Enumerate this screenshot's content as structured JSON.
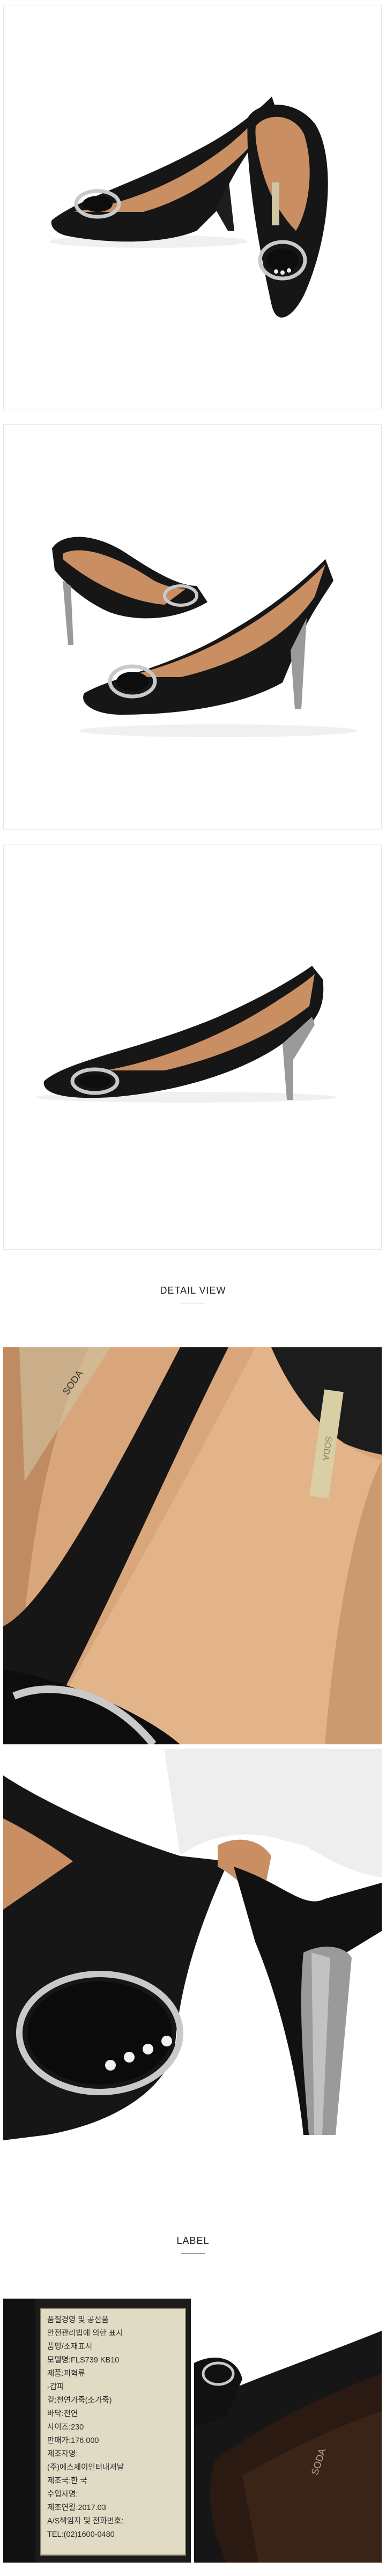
{
  "sections": {
    "detail_view": "DETAIL VIEW",
    "label": "LABEL"
  },
  "brand_mark": "SODA",
  "label_tag": {
    "lines": [
      "품질경영 및 공산품",
      "안전관리법에 의한 표시",
      "품명/소재표시",
      "모델명:FLS739 KB10",
      "제품:피혁류",
      "-갑피",
      "겉:천연가죽(소가죽)",
      "바닥:천연",
      "사이즈:230",
      "판매가:176,000",
      "제조자명:",
      "(주)에스제이인터내셔날",
      "제조국:한 국",
      "수입자명:",
      "제조연월:2017.03",
      "A/S책임자 및 전화번호:",
      "TEL:(02)1600-0480"
    ]
  },
  "colors": {
    "leather": "#161616",
    "lining": "#c98e62",
    "buckle": "#c9c9c9",
    "heel_metal": "#9a9a9a"
  }
}
